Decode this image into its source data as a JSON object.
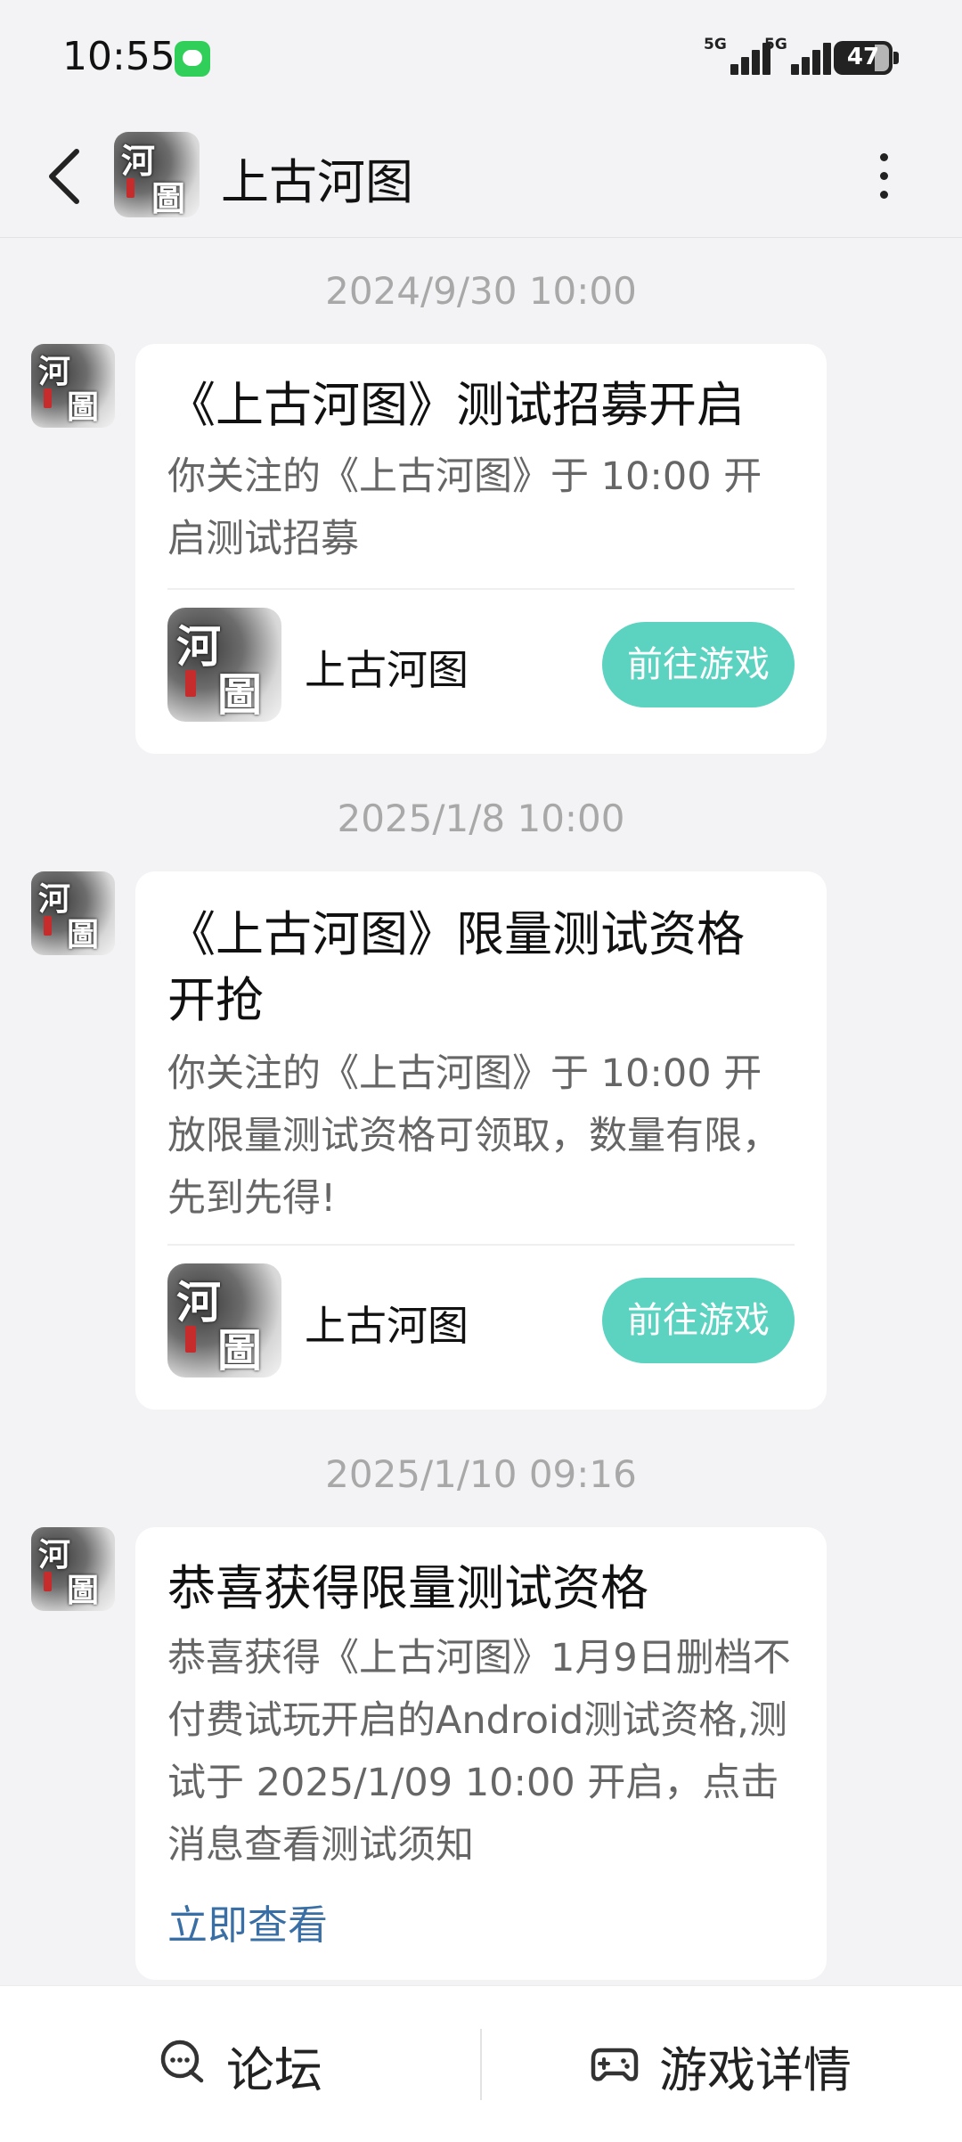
{
  "status_bar": {
    "time": "10:55",
    "network1": "5G",
    "network2": "5G",
    "battery": "47"
  },
  "header": {
    "title": "上古河图"
  },
  "messages": [
    {
      "timestamp": "2024/9/30  10:00",
      "title": "《上古河图》测试招募开启",
      "body": "你关注的《上古河图》于 10:00 开启测试招募",
      "app_name": "上古河图",
      "button_label": "前往游戏"
    },
    {
      "timestamp": "2025/1/8  10:00",
      "title": "《上古河图》限量测试资格开抢",
      "body": "你关注的《上古河图》于 10:00 开放限量测试资格可领取，数量有限，先到先得!",
      "app_name": "上古河图",
      "button_label": "前往游戏"
    },
    {
      "timestamp": "2025/1/10  09:16",
      "title": "恭喜获得限量测试资格",
      "body": "恭喜获得《上古河图》1月9日删档不付费试玩开启的Android测试资格,测试于 2025/1/09 10:00 开启，点击消息查看测试须知",
      "link_label": "立即查看"
    }
  ],
  "bottom_bar": {
    "forum_label": "论坛",
    "game_details_label": "游戏详情"
  },
  "logo_glyphs": [
    "河",
    "圖"
  ],
  "colors": {
    "accent_button": "#5cd3c0",
    "link": "#3a6fa5",
    "background": "#f3f3f5"
  },
  "icons": [
    "chevron-left-icon",
    "more-vertical-icon",
    "chat-icon",
    "gamepad-icon",
    "signal-icon",
    "battery-icon",
    "message-app-icon"
  ]
}
